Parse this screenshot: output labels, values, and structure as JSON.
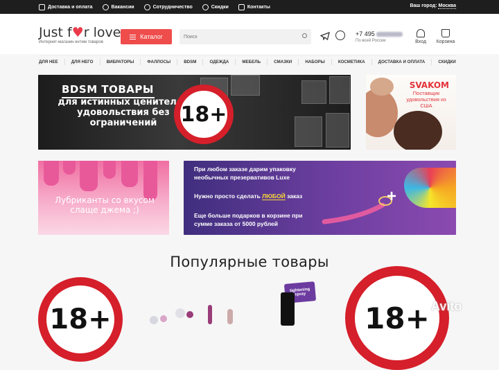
{
  "topbar": {
    "links": [
      {
        "label": "Доставка и оплата",
        "icon": "truck-icon"
      },
      {
        "label": "Вакансии",
        "icon": "people-icon"
      },
      {
        "label": "Сотрудничество",
        "icon": "globe-icon"
      },
      {
        "label": "Скидки",
        "icon": "percent-icon"
      },
      {
        "label": "Контакты",
        "icon": "mail-icon"
      }
    ],
    "city_label": "Ваш город:",
    "city": "Москва"
  },
  "header": {
    "logo_pre": "Just f",
    "logo_post": "r love",
    "logo_sub": "Интернет-магазин интим товаров",
    "catalog_label": "Каталог",
    "search_placeholder": "Поиск",
    "phone_prefix": "+7 495",
    "phone_sub": "По всей России",
    "login_label": "Вход",
    "cart_label": "Корзина"
  },
  "nav": [
    "ДЛЯ НЕЕ",
    "ДЛЯ НЕГО",
    "ВИБРАТОРЫ",
    "ФАЛЛОСЫ",
    "BDSM",
    "ОДЕЖДА",
    "МЕБЕЛЬ",
    "СМАЗКИ",
    "НАБОРЫ",
    "КОСМЕТИКА",
    "ДОСТАВКА И ОПЛАТА",
    "СКИДКИ"
  ],
  "banners": {
    "bdsm_title": "BDSM ТОВАРЫ",
    "bdsm_sub": "для истинных ценителей удовольствия без ограничений",
    "age_mark": "18+",
    "svakom_brand": "SVAKOM",
    "svakom_text": "Поставщик удовольствия из США",
    "lube_text": "Лубриканты со вкусом слаще джема ;)",
    "gift_line1": "При любом заказе дарим упаковку",
    "gift_line2": "необычных презервативов Luxe",
    "gift_line3_a": "Нужно просто сделать",
    "gift_line3_hl": "ЛЮБОЙ",
    "gift_line3_b": "заказ",
    "gift_line4": "Еще больше подарков в корзине при",
    "gift_line5": "сумме заказа от 5000 рублей",
    "plus": "+"
  },
  "popular_title": "Популярные товары",
  "products": {
    "spray_label": "tightening spray"
  },
  "watermark": "Avito",
  "colors": {
    "accent": "#ef4c4c",
    "age_ring": "#d51f2a",
    "topbar": "#1e1e1e"
  }
}
